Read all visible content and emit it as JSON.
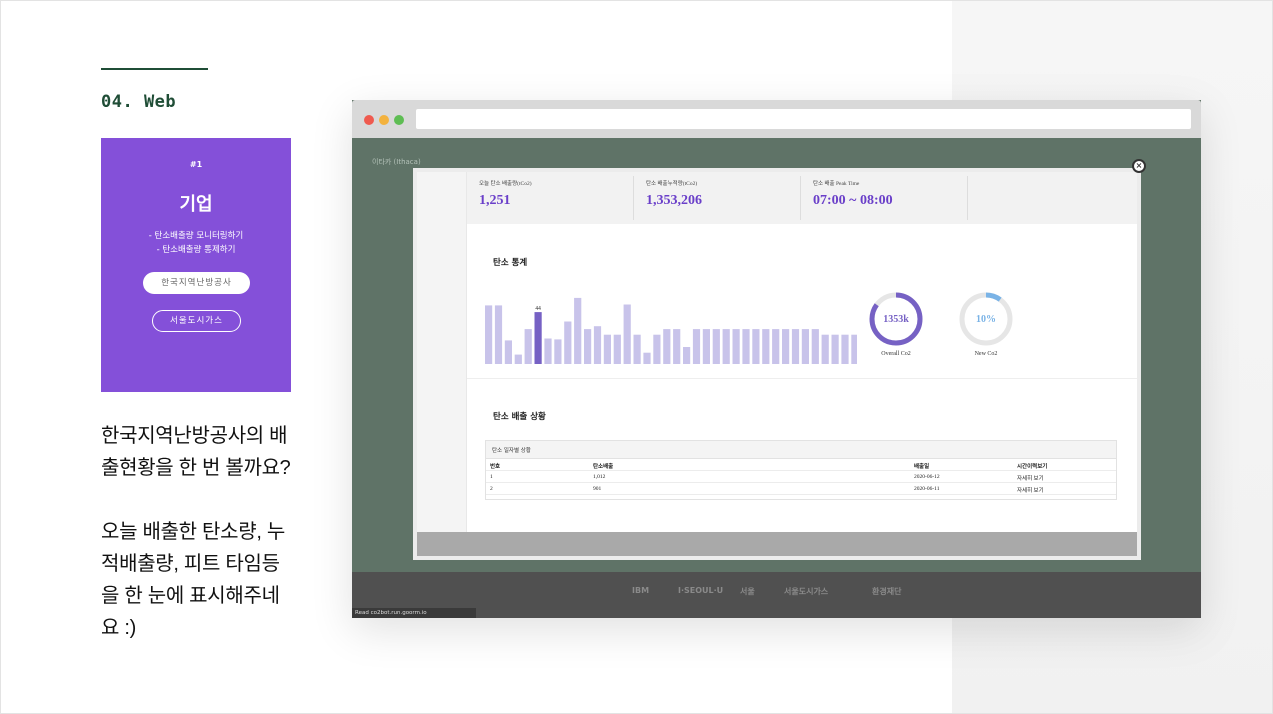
{
  "section": {
    "title": "04. Web"
  },
  "phone": {
    "num": "#1",
    "title": "기업",
    "desc_1": "- 탄소배출량 모니터링하기",
    "desc_2": "- 탄소배출량 통제하기",
    "btn_primary": "한국지역난방공사",
    "btn_secondary": "서울도시가스"
  },
  "caption": {
    "p1_l1": "한국지역난방공사의 배",
    "p1_l2": "출현황을 한 번 볼까요?",
    "p2_l1": "오늘 배출한 탄소량, 누",
    "p2_l2": "적배출량, 피트 타임등",
    "p2_l3": "을 한 눈에 표시해주네",
    "p2_l4": "요 :)"
  },
  "browser": {
    "site_name": "이타카 (Ithaca)",
    "status_text": "Read co2bot.run.goorm.io",
    "close_glyph": "×",
    "logos": [
      "IBM",
      "I·SEOUL·U",
      "서울",
      "서울도시가스",
      "환경재단"
    ]
  },
  "stats": [
    {
      "label": "오늘 탄소 배출량(tCo2)",
      "value": "1,251"
    },
    {
      "label": "탄소 배출누적량(tCo2)",
      "value": "1,353,206"
    },
    {
      "label": "탄소 배출 Peak Time",
      "value": "07:00 ~ 08:00"
    }
  ],
  "stats_section": {
    "title": "탄소 통계"
  },
  "status_section": {
    "title": "탄소 배출 상황"
  },
  "donuts": [
    {
      "value_label": "1353k",
      "caption": "Overall Co2",
      "fraction": 0.85,
      "color": "#7661c4"
    },
    {
      "value_label": "10%",
      "caption": "New Co2",
      "fraction": 0.1,
      "color": "#7ab3e6"
    }
  ],
  "table": {
    "title": "탄소 일자별 상황",
    "columns": [
      "번호",
      "탄소배출",
      "배출일",
      "시간이력보기"
    ],
    "rows": [
      [
        "1",
        "1,012",
        "2020-06-12",
        "자세히 보기"
      ],
      [
        "2",
        "901",
        "2020-06-11",
        "자세히 보기"
      ]
    ]
  },
  "chart_data": {
    "type": "bar",
    "title": "탄소 통계",
    "values": [
      62,
      62,
      25,
      10,
      37,
      55,
      27,
      26,
      45,
      70,
      37,
      40,
      31,
      31,
      63,
      31,
      12,
      31,
      37,
      37,
      18,
      37,
      37,
      37,
      37,
      37,
      37,
      37,
      37,
      37,
      37,
      37,
      37,
      37,
      31,
      31,
      31,
      31
    ],
    "highlight_index": 5,
    "highlight_label": "44",
    "bar_color": "#c8c3ea",
    "highlight_color": "#7661c4"
  }
}
